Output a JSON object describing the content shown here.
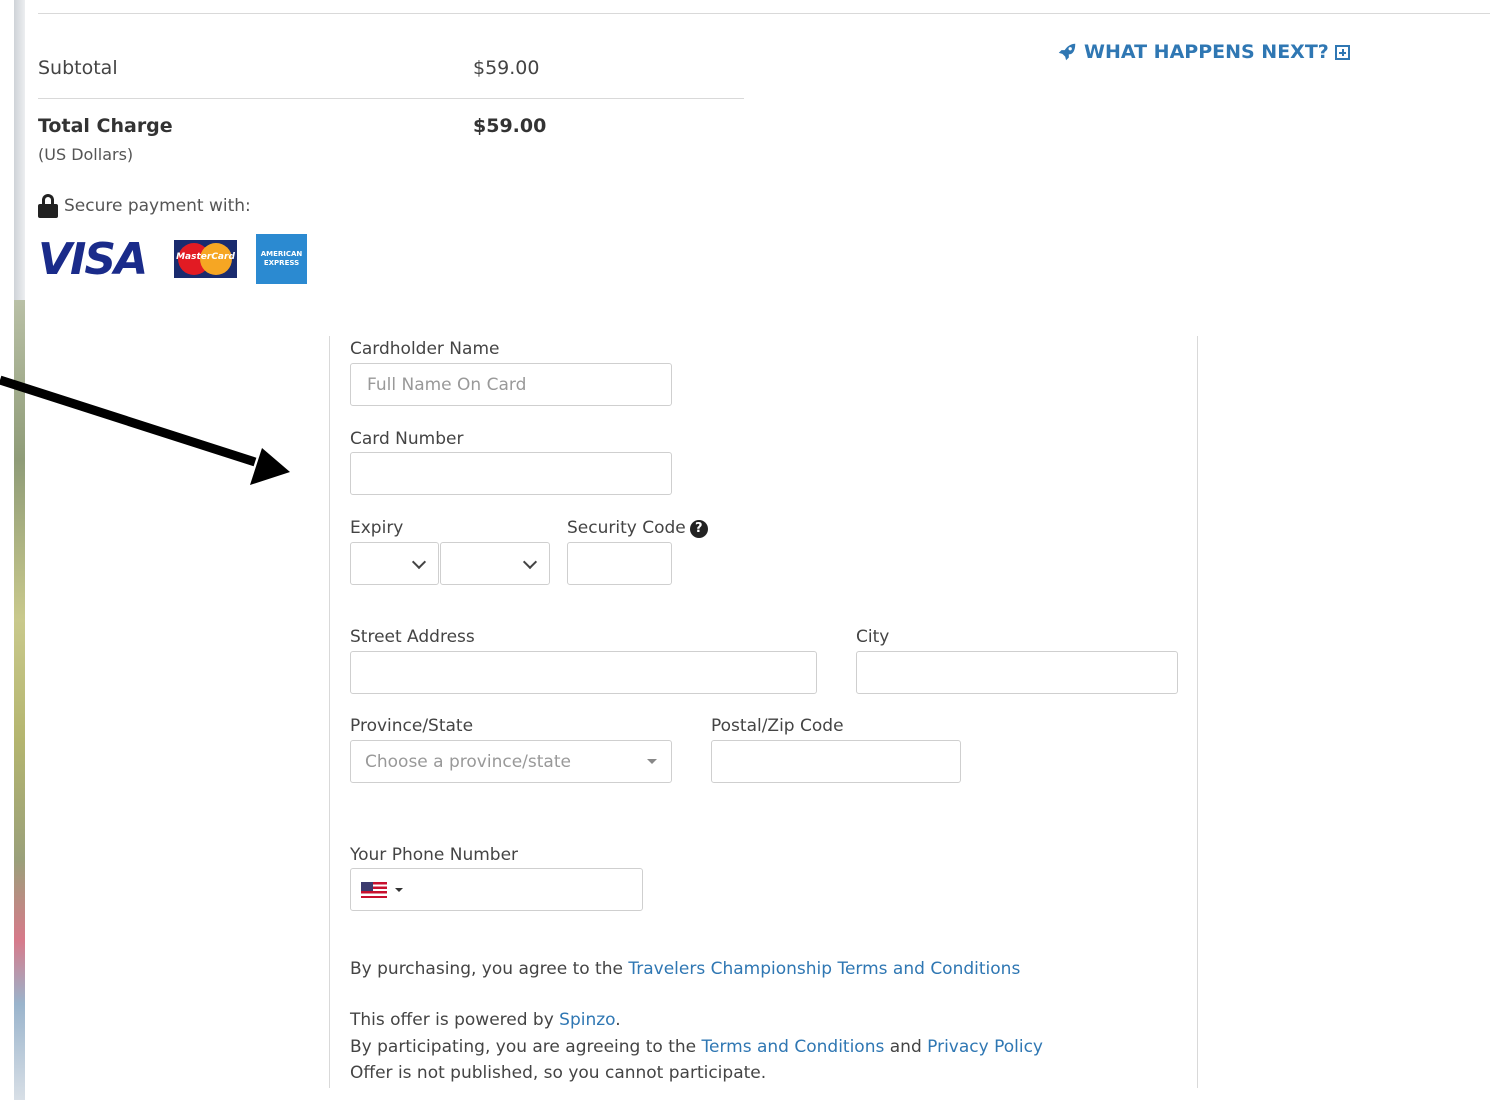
{
  "summary": {
    "subtotal_label": "Subtotal",
    "subtotal_value": "$59.00",
    "total_label": "Total Charge",
    "total_value": "$59.00",
    "currency_note": "(US Dollars)",
    "what_happens_next": "WHAT HAPPENS NEXT?",
    "secure_label": "Secure payment with:"
  },
  "cards": {
    "visa": "VISA",
    "mastercard": "MasterCard",
    "amex": "AMERICAN EXPRESS"
  },
  "form": {
    "cardholder_label": "Cardholder Name",
    "cardholder_placeholder": "Full Name On Card",
    "card_number_label": "Card Number",
    "expiry_label": "Expiry",
    "security_code_label": "Security Code",
    "security_help_glyph": "?",
    "street_label": "Street Address",
    "city_label": "City",
    "province_label": "Province/State",
    "province_placeholder": "Choose a province/state",
    "postal_label": "Postal/Zip Code",
    "phone_label": "Your Phone Number"
  },
  "legal": {
    "purchase_prefix": "By purchasing, you agree to the ",
    "purchase_link": "Travelers Championship Terms and Conditions",
    "powered_prefix": "This offer is powered by ",
    "powered_link": "Spinzo",
    "powered_suffix": ".",
    "participate_prefix": "By participating, you are agreeing to the ",
    "terms_link": "Terms and Conditions",
    "and_text": " and ",
    "privacy_link": "Privacy Policy",
    "not_published": "Offer is not published, so you cannot participate."
  },
  "colors": {
    "link": "#2f77b3",
    "visa": "#1a2b8a",
    "amex": "#2b8ad1"
  }
}
